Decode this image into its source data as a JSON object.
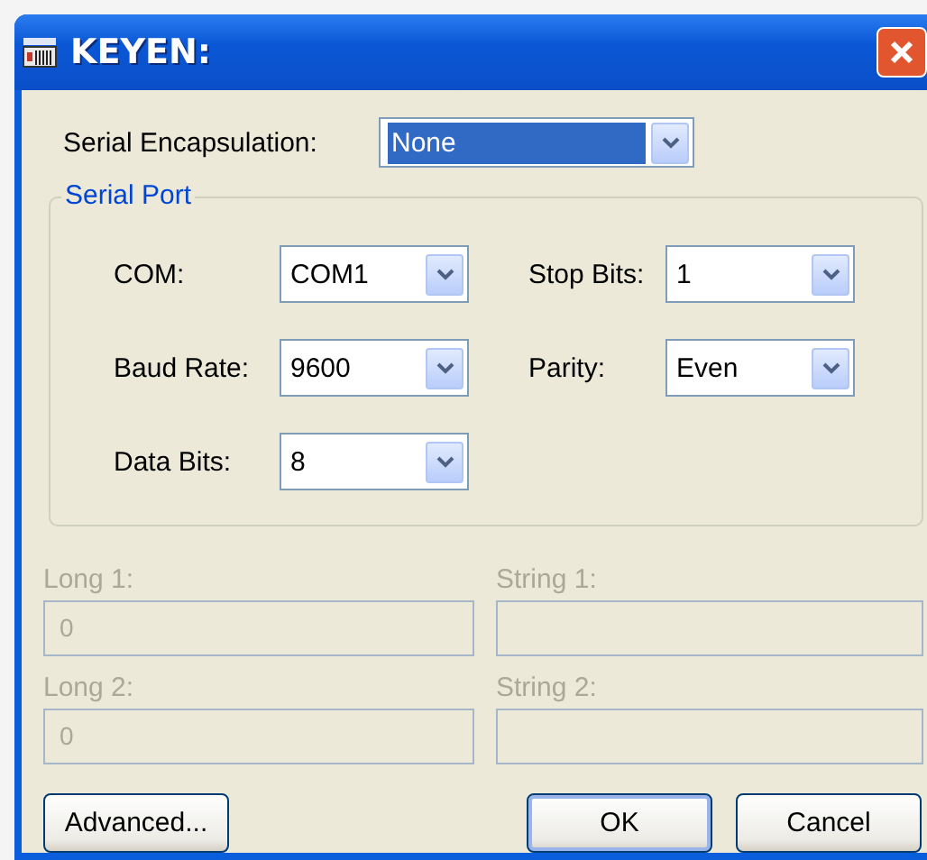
{
  "window": {
    "title": "KEYEN:"
  },
  "encapsulation": {
    "label": "Serial Encapsulation:",
    "value": "None",
    "selected": true
  },
  "serial_port": {
    "title": "Serial Port",
    "fields": [
      {
        "label": "COM:",
        "value": "COM1"
      },
      {
        "label": "Stop Bits:",
        "value": "1"
      },
      {
        "label": "Baud Rate:",
        "value": "9600"
      },
      {
        "label": "Parity:",
        "value": "Even"
      },
      {
        "label": "Data Bits:",
        "value": "8"
      }
    ]
  },
  "parameters": [
    {
      "label": "Long 1:",
      "value": "0",
      "disabled": true
    },
    {
      "label": "String 1:",
      "disabled": true
    },
    {
      "label": "Long 2:",
      "value": "0",
      "disabled": true
    },
    {
      "label": "String 2:",
      "disabled": true
    }
  ],
  "buttons": [
    {
      "label": "Advanced...",
      "default": false
    },
    {
      "label": "OK",
      "default": true
    },
    {
      "label": "Cancel",
      "default": false
    }
  ]
}
